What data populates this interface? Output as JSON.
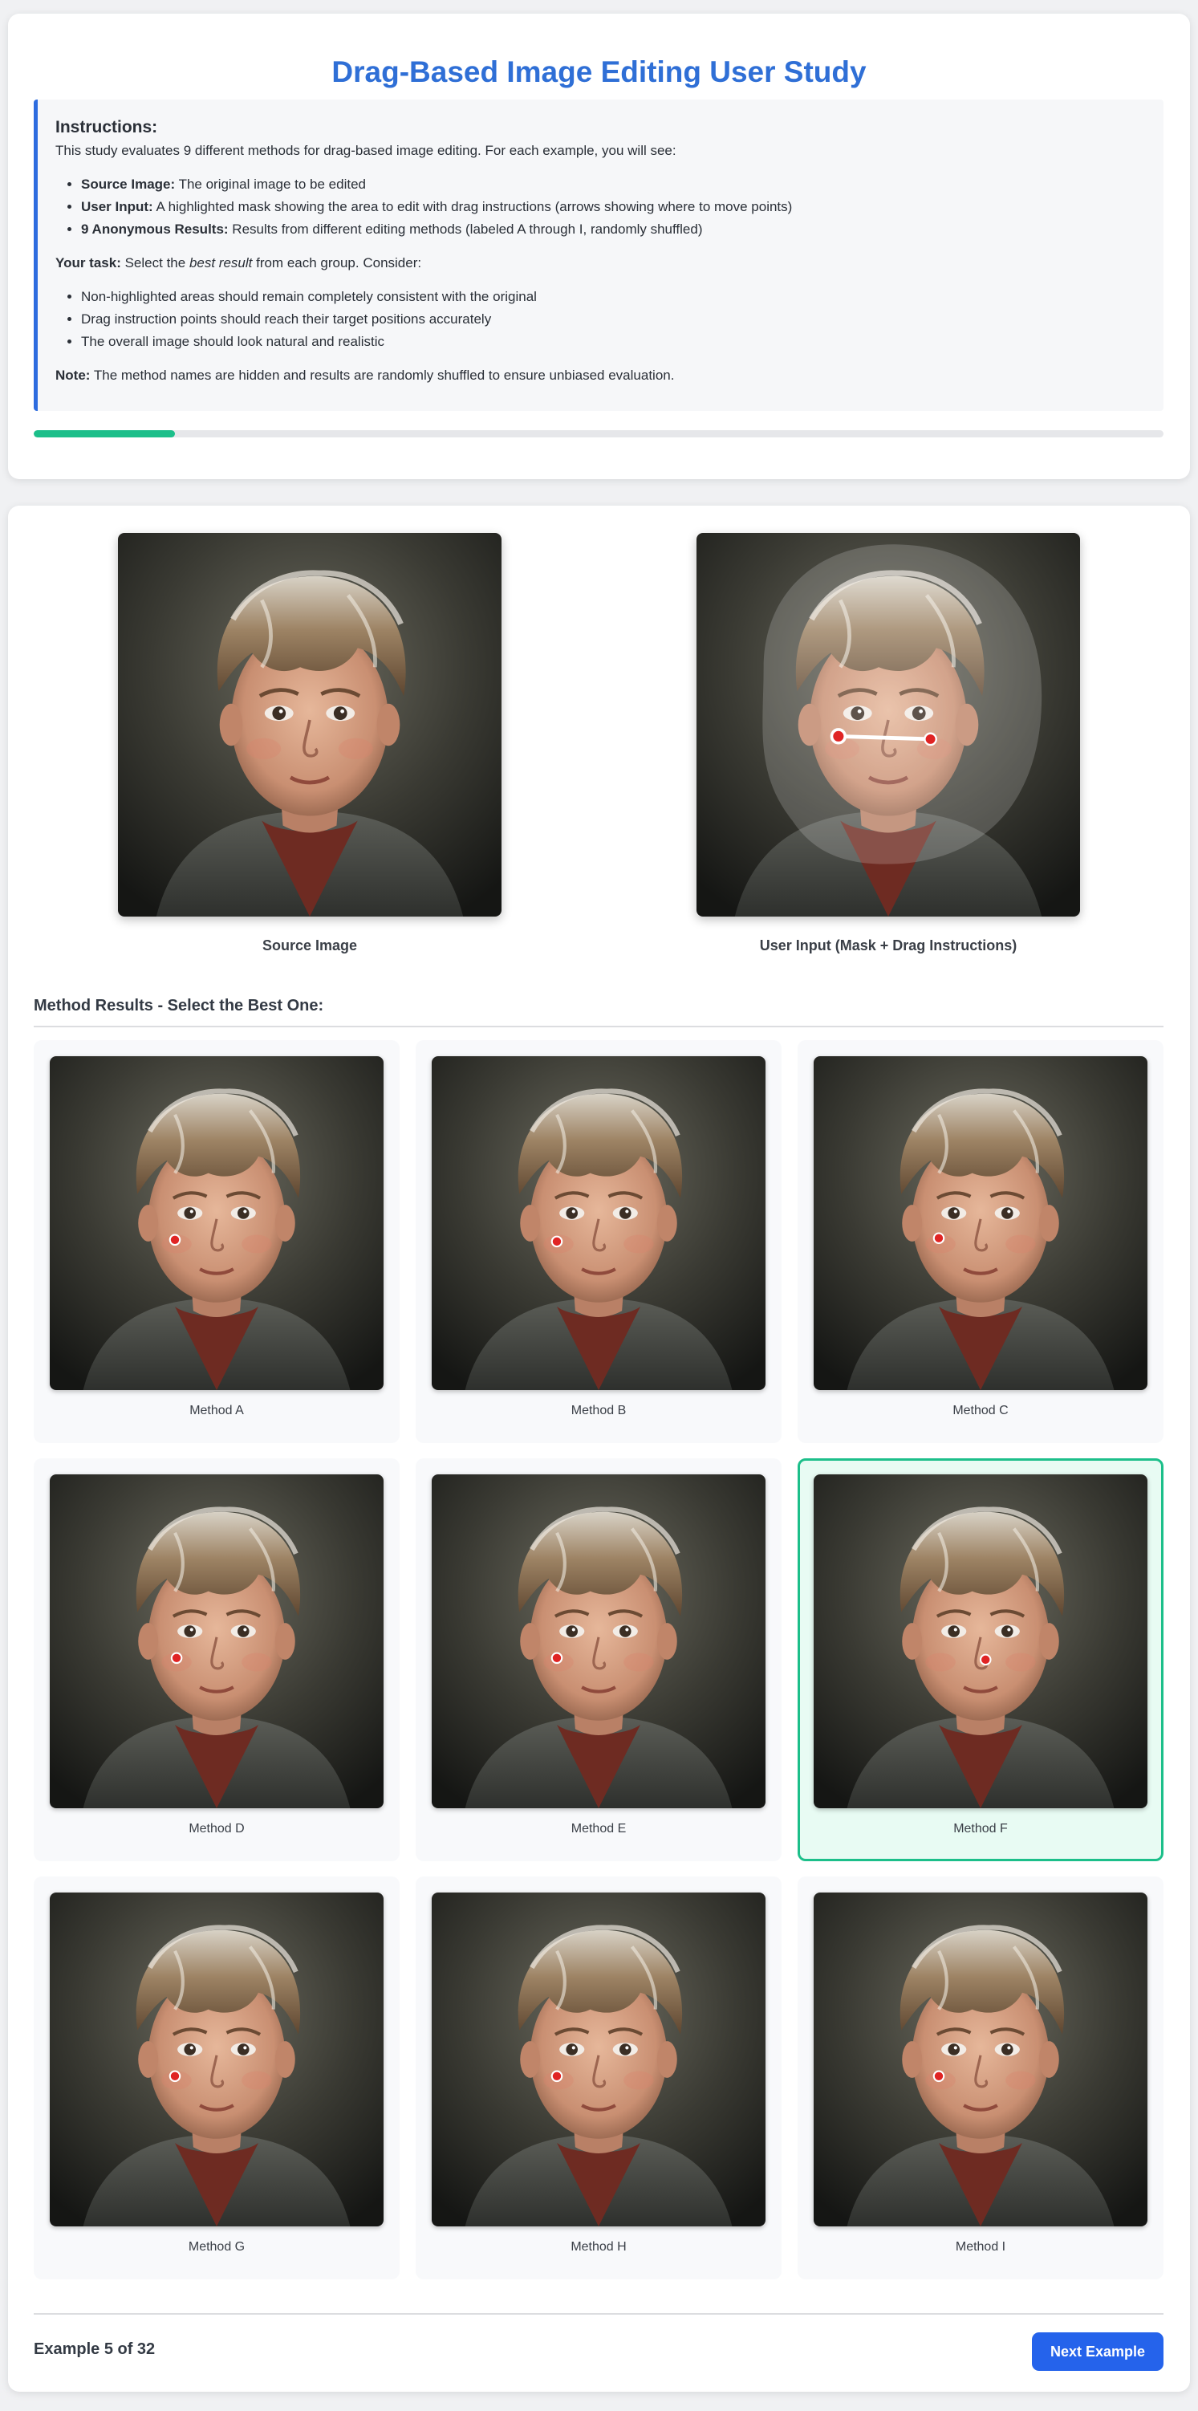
{
  "header": {
    "title": "Drag-Based Image Editing User Study"
  },
  "instructions": {
    "heading": "Instructions:",
    "intro": "This study evaluates 9 different methods for drag-based image editing. For each example, you will see:",
    "items": [
      {
        "label": "Source Image:",
        "text": " The original image to be edited"
      },
      {
        "label": "User Input:",
        "text": " A highlighted mask showing the area to edit with drag instructions (arrows showing where to move points)"
      },
      {
        "label": "9 Anonymous Results:",
        "text": " Results from different editing methods (labeled A through I, randomly shuffled)"
      }
    ],
    "task_label": "Your task:",
    "task_pre": " Select the ",
    "task_em": "best result",
    "task_post": " from each group. Consider:",
    "criteria": [
      "Non-highlighted areas should remain completely consistent with the original",
      "Drag instruction points should reach their target positions accurately",
      "The overall image should look natural and realistic"
    ],
    "note_label": "Note:",
    "note_text": " The method names are hidden and results are randomly shuffled to ensure unbiased evaluation."
  },
  "progress": {
    "fraction": 0.125
  },
  "source": {
    "caption": "Source Image"
  },
  "user_input": {
    "caption": "User Input (Mask + Drag Instructions)"
  },
  "methods": {
    "title": "Method Results - Select the Best One:",
    "items": [
      {
        "label": "Method A"
      },
      {
        "label": "Method B"
      },
      {
        "label": "Method C"
      },
      {
        "label": "Method D"
      },
      {
        "label": "Method E"
      },
      {
        "label": "Method F"
      },
      {
        "label": "Method G"
      },
      {
        "label": "Method H"
      },
      {
        "label": "Method I"
      }
    ],
    "selected": "Method F"
  },
  "footer": {
    "counter": "Example 5 of 32",
    "next_label": "Next Example"
  },
  "colors": {
    "title": "#2f6fd6",
    "accent": "#2d6cdf",
    "progress": "#1cbf8a",
    "selected_border": "#1cbf8a",
    "button": "#2563eb",
    "drag_point": "#e02424"
  }
}
